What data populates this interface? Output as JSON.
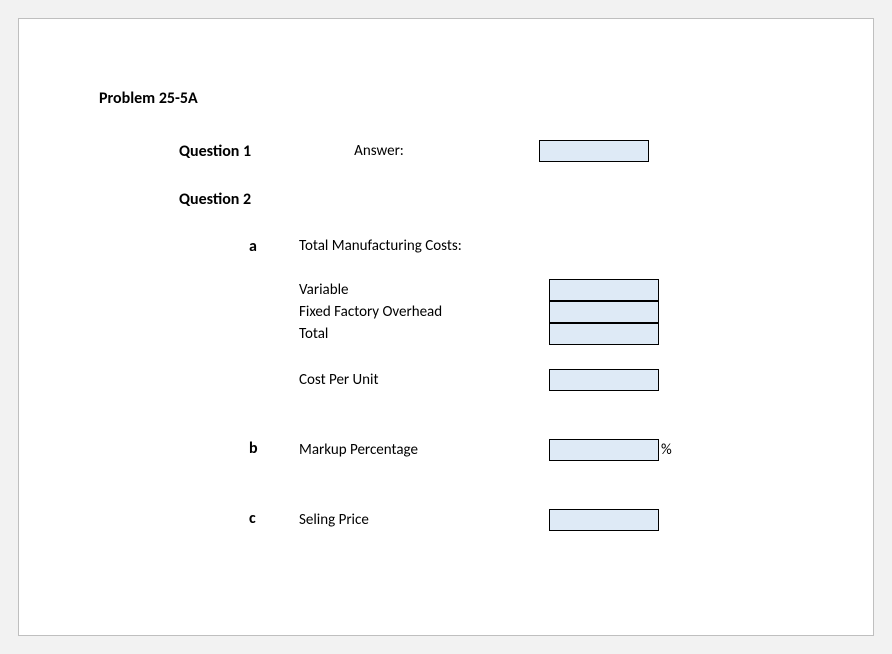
{
  "problem": {
    "title": "Problem 25-5A"
  },
  "question1": {
    "label": "Question 1",
    "answer_label": "Answer:",
    "answer_value": ""
  },
  "question2": {
    "label": "Question 2",
    "parts": {
      "a": {
        "letter": "a",
        "title": "Total Manufacturing Costs:",
        "rows": {
          "variable": {
            "label": "Variable",
            "value": ""
          },
          "fixed_overhead": {
            "label": "Fixed Factory Overhead",
            "value": ""
          },
          "total": {
            "label": "Total",
            "value": ""
          },
          "cost_per_unit": {
            "label": "Cost Per Unit",
            "value": ""
          }
        }
      },
      "b": {
        "letter": "b",
        "label": "Markup Percentage",
        "value": "",
        "suffix": "%"
      },
      "c": {
        "letter": "c",
        "label": "Seling Price",
        "value": ""
      }
    }
  }
}
